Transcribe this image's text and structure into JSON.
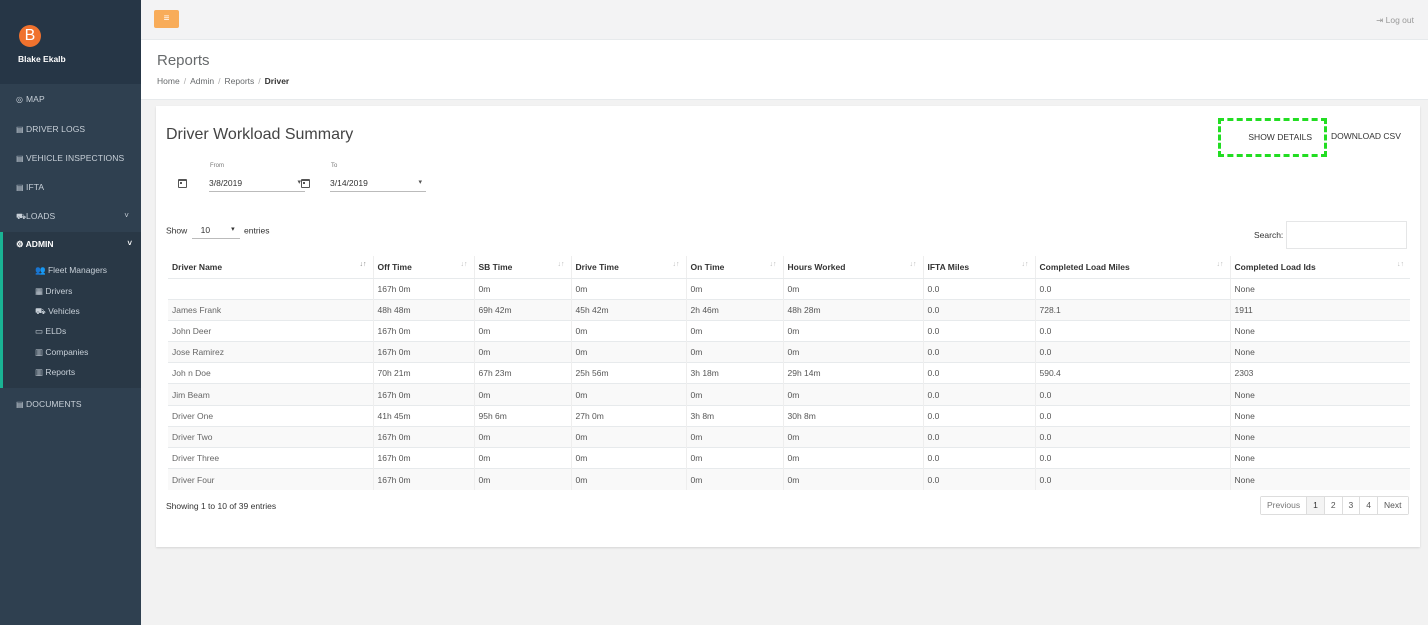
{
  "user": {
    "initial": "B",
    "name": "Blake Ekalb"
  },
  "sidebar": {
    "items": [
      {
        "label": "MAP",
        "icon": "◎"
      },
      {
        "label": "DRIVER LOGS",
        "icon": "▤"
      },
      {
        "label": "VEHICLE INSPECTIONS",
        "icon": "▤"
      },
      {
        "label": "IFTA",
        "icon": "▤"
      },
      {
        "label": "LOADS",
        "icon": "⛟",
        "caret": "˅"
      }
    ],
    "admin": {
      "label": "ADMIN",
      "icon": "⚙",
      "caret": "˅"
    },
    "admin_items": [
      {
        "label": "Fleet Managers",
        "icon": "👥"
      },
      {
        "label": "Drivers",
        "icon": "▦"
      },
      {
        "label": "Vehicles",
        "icon": "⛟"
      },
      {
        "label": "ELDs",
        "icon": "▭"
      },
      {
        "label": "Companies",
        "icon": "▥"
      },
      {
        "label": "Reports",
        "icon": "▥"
      }
    ],
    "documents": {
      "label": "DOCUMENTS",
      "icon": "▤"
    }
  },
  "topbar": {
    "menu_icon": "≡",
    "logout_icon": "⇥",
    "logout_label": "Log out"
  },
  "page": {
    "title": "Reports",
    "breadcrumb": [
      "Home",
      "Admin",
      "Reports",
      "Driver"
    ],
    "breadcrumb_sep": "/"
  },
  "card": {
    "title": "Driver Workload Summary",
    "show_details": "SHOW DETAILS",
    "download_csv": "DOWNLOAD CSV",
    "from_label": "From",
    "from_value": "3/8/2019",
    "to_label": "To",
    "to_value": "3/14/2019",
    "dropdown_icon": "▾"
  },
  "entries": {
    "show": "Show",
    "value": "10",
    "suffix": "entries",
    "dropdown_icon": "▾"
  },
  "search": {
    "label": "Search:",
    "value": ""
  },
  "table": {
    "columns": [
      "Driver Name",
      "Off Time",
      "SB Time",
      "Drive Time",
      "On Time",
      "Hours Worked",
      "IFTA Miles",
      "Completed Load Miles",
      "Completed Load Ids"
    ],
    "sort_icon": "↓↑",
    "rows": [
      [
        "",
        "167h 0m",
        "0m",
        "0m",
        "0m",
        "0m",
        "0.0",
        "0.0",
        "None"
      ],
      [
        "James Frank",
        "48h 48m",
        "69h 42m",
        "45h 42m",
        "2h 46m",
        "48h 28m",
        "0.0",
        "728.1",
        "1911"
      ],
      [
        "John Deer",
        "167h 0m",
        "0m",
        "0m",
        "0m",
        "0m",
        "0.0",
        "0.0",
        "None"
      ],
      [
        "Jose Ramirez",
        "167h 0m",
        "0m",
        "0m",
        "0m",
        "0m",
        "0.0",
        "0.0",
        "None"
      ],
      [
        "Joh n Doe",
        "70h 21m",
        "67h 23m",
        "25h 56m",
        "3h 18m",
        "29h 14m",
        "0.0",
        "590.4",
        "2303"
      ],
      [
        "Jim Beam",
        "167h 0m",
        "0m",
        "0m",
        "0m",
        "0m",
        "0.0",
        "0.0",
        "None"
      ],
      [
        "Driver One",
        "41h 45m",
        "95h 6m",
        "27h 0m",
        "3h 8m",
        "30h 8m",
        "0.0",
        "0.0",
        "None"
      ],
      [
        "Driver Two",
        "167h 0m",
        "0m",
        "0m",
        "0m",
        "0m",
        "0.0",
        "0.0",
        "None"
      ],
      [
        "Driver Three",
        "167h 0m",
        "0m",
        "0m",
        "0m",
        "0m",
        "0.0",
        "0.0",
        "None"
      ],
      [
        "Driver Four",
        "167h 0m",
        "0m",
        "0m",
        "0m",
        "0m",
        "0.0",
        "0.0",
        "None"
      ]
    ]
  },
  "footer": {
    "info": "Showing 1 to 10 of 39 entries",
    "pager": [
      "Previous",
      "1",
      "2",
      "3",
      "4",
      "Next"
    ],
    "active_page": "1"
  },
  "colors": {
    "sidebar": "#2f4050",
    "accent": "#f8ac59",
    "highlight": "#22dd22",
    "avatar": "#f0722e"
  }
}
